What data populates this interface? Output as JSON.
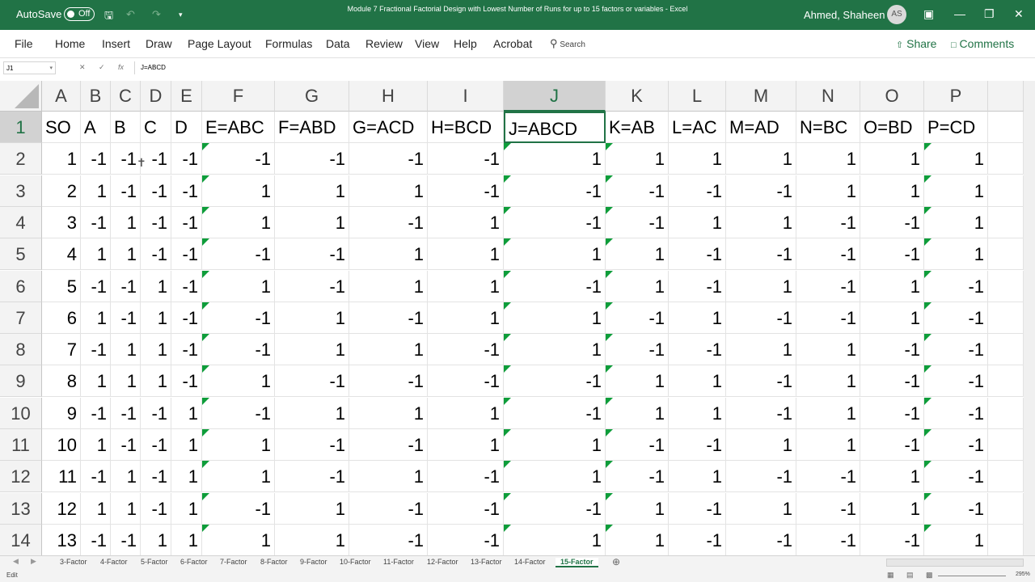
{
  "window": {
    "autosave_label": "AutoSave",
    "autosave_state": "Off",
    "title": "Module 7 Fractional Factorial Design with Lowest Number of Runs for up to 15 factors or variables  -  Excel",
    "user_name": "Ahmed, Shaheen",
    "user_initials": "AS"
  },
  "ribbon": {
    "tabs": [
      "File",
      "Home",
      "Insert",
      "Draw",
      "Page Layout",
      "Formulas",
      "Data",
      "Review",
      "View",
      "Help",
      "Acrobat"
    ],
    "search_placeholder": "Search",
    "share_label": "Share",
    "comments_label": "Comments"
  },
  "formula_bar": {
    "name_box": "J1",
    "formula": "J=ABCD"
  },
  "grid": {
    "columns": [
      "A",
      "B",
      "C",
      "D",
      "E",
      "F",
      "G",
      "H",
      "I",
      "J",
      "K",
      "L",
      "M",
      "N",
      "O",
      "P"
    ],
    "selected_column": "J",
    "selected_row": "1",
    "row_numbers": [
      "1",
      "2",
      "3",
      "4",
      "5",
      "6",
      "7",
      "8",
      "9",
      "10",
      "11",
      "12",
      "13",
      "14"
    ],
    "rows": [
      [
        "SO",
        "A",
        "B",
        "C",
        "D",
        "E=ABC",
        "F=ABD",
        "G=ACD",
        "H=BCD",
        "J=ABCD",
        "K=AB",
        "L=AC",
        "M=AD",
        "N=BC",
        "O=BD",
        "P=CD"
      ],
      [
        "1",
        "-1",
        "-1",
        "-1",
        "-1",
        "-1",
        "-1",
        "-1",
        "-1",
        "1",
        "1",
        "1",
        "1",
        "1",
        "1",
        "1"
      ],
      [
        "2",
        "1",
        "-1",
        "-1",
        "-1",
        "1",
        "1",
        "1",
        "-1",
        "-1",
        "-1",
        "-1",
        "-1",
        "1",
        "1",
        "1"
      ],
      [
        "3",
        "-1",
        "1",
        "-1",
        "-1",
        "1",
        "1",
        "-1",
        "1",
        "-1",
        "-1",
        "1",
        "1",
        "-1",
        "-1",
        "1"
      ],
      [
        "4",
        "1",
        "1",
        "-1",
        "-1",
        "-1",
        "-1",
        "1",
        "1",
        "1",
        "1",
        "-1",
        "-1",
        "-1",
        "-1",
        "1"
      ],
      [
        "5",
        "-1",
        "-1",
        "1",
        "-1",
        "1",
        "-1",
        "1",
        "1",
        "-1",
        "1",
        "-1",
        "1",
        "-1",
        "1",
        "-1"
      ],
      [
        "6",
        "1",
        "-1",
        "1",
        "-1",
        "-1",
        "1",
        "-1",
        "1",
        "1",
        "-1",
        "1",
        "-1",
        "-1",
        "1",
        "-1"
      ],
      [
        "7",
        "-1",
        "1",
        "1",
        "-1",
        "-1",
        "1",
        "1",
        "-1",
        "1",
        "-1",
        "-1",
        "1",
        "1",
        "-1",
        "-1"
      ],
      [
        "8",
        "1",
        "1",
        "1",
        "-1",
        "1",
        "-1",
        "-1",
        "-1",
        "-1",
        "1",
        "1",
        "-1",
        "1",
        "-1",
        "-1"
      ],
      [
        "9",
        "-1",
        "-1",
        "-1",
        "1",
        "-1",
        "1",
        "1",
        "1",
        "-1",
        "1",
        "1",
        "-1",
        "1",
        "-1",
        "-1"
      ],
      [
        "10",
        "1",
        "-1",
        "-1",
        "1",
        "1",
        "-1",
        "-1",
        "1",
        "1",
        "-1",
        "-1",
        "1",
        "1",
        "-1",
        "-1"
      ],
      [
        "11",
        "-1",
        "1",
        "-1",
        "1",
        "1",
        "-1",
        "1",
        "-1",
        "1",
        "-1",
        "1",
        "-1",
        "-1",
        "1",
        "-1"
      ],
      [
        "12",
        "1",
        "1",
        "-1",
        "1",
        "-1",
        "1",
        "-1",
        "-1",
        "-1",
        "1",
        "-1",
        "1",
        "-1",
        "1",
        "-1"
      ],
      [
        "13",
        "-1",
        "-1",
        "1",
        "1",
        "1",
        "1",
        "-1",
        "-1",
        "1",
        "1",
        "-1",
        "-1",
        "-1",
        "-1",
        "1"
      ]
    ]
  },
  "sheet_tabs": [
    "3-Factor",
    "4-Factor",
    "5-Factor",
    "6-Factor",
    "7-Factor",
    "8-Factor",
    "9-Factor",
    "10-Factor",
    "11-Factor",
    "12-Factor",
    "13-Factor",
    "14-Factor",
    "15-Factor"
  ],
  "active_sheet": "15-Factor",
  "status": {
    "mode": "Edit",
    "zoom": "295%"
  },
  "colors": {
    "accent": "#217346",
    "indicator": "#0e9d3a"
  }
}
